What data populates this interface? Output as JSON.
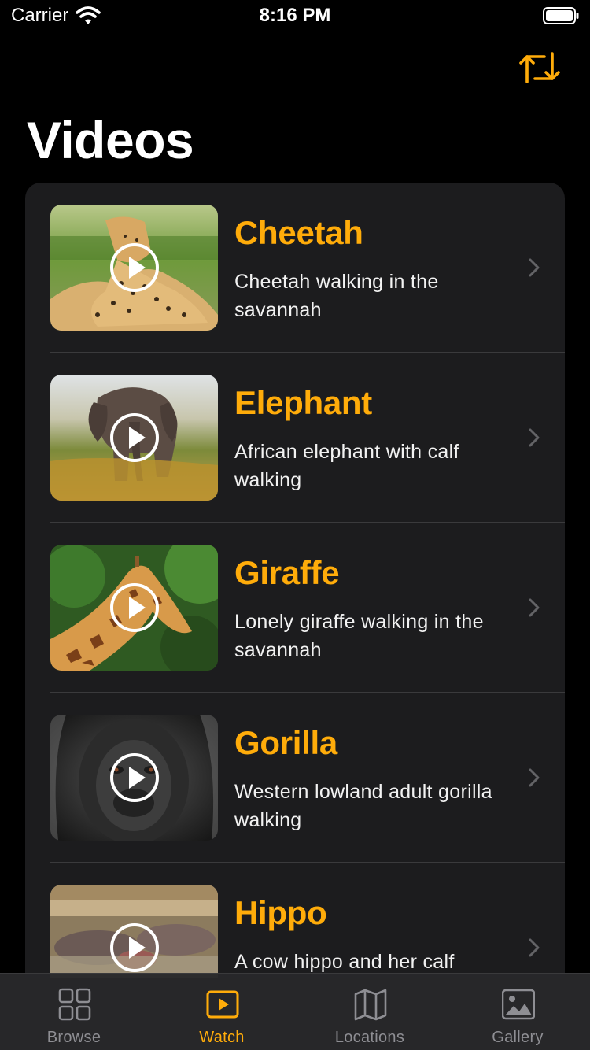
{
  "status_bar": {
    "carrier": "Carrier",
    "time": "8:16 PM"
  },
  "nav": {
    "title": "Videos",
    "action_icon": "rotate-arrows-icon"
  },
  "accent_color": "#ffac0a",
  "videos": [
    {
      "title": "Cheetah",
      "description": "Cheetah walking in the savannah",
      "thumbnail": "cheetah"
    },
    {
      "title": "Elephant",
      "description": "African elephant with calf walking",
      "thumbnail": "elephant"
    },
    {
      "title": "Giraffe",
      "description": "Lonely giraffe walking in the savannah",
      "thumbnail": "giraffe"
    },
    {
      "title": "Gorilla",
      "description": "Western lowland adult gorilla walking",
      "thumbnail": "gorilla"
    },
    {
      "title": "Hippo",
      "description": "A cow hippo and her calf",
      "thumbnail": "hippo"
    }
  ],
  "tab_bar": {
    "selected": "Watch",
    "tabs": [
      {
        "label": "Browse",
        "icon": "grid-icon"
      },
      {
        "label": "Watch",
        "icon": "play-rectangle-icon"
      },
      {
        "label": "Locations",
        "icon": "map-icon"
      },
      {
        "label": "Gallery",
        "icon": "photo-icon"
      }
    ]
  }
}
